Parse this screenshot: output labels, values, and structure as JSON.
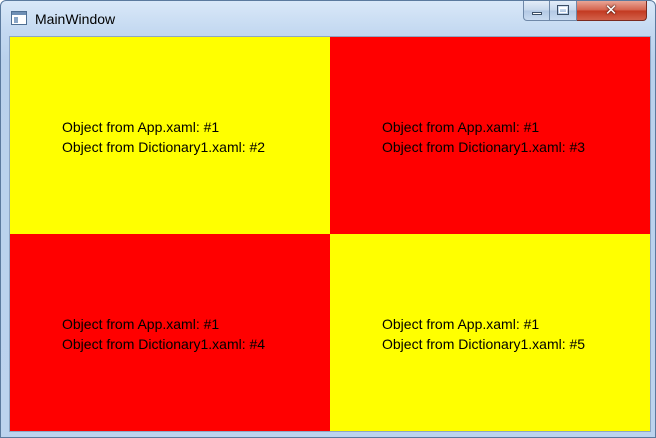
{
  "window": {
    "title": "MainWindow",
    "controls": {
      "minimize_icon": "minimize-icon",
      "maximize_icon": "maximize-icon",
      "close_icon": "close-icon",
      "close_glyph": "✕"
    }
  },
  "colors": {
    "yellow": "#ffff00",
    "red": "#ff0000"
  },
  "grid": {
    "cells": [
      {
        "id": "top-left",
        "color": "yellow",
        "line1": "Object from App.xaml: #1",
        "line2": "Object from Dictionary1.xaml: #2"
      },
      {
        "id": "top-right",
        "color": "red",
        "line1": "Object from App.xaml: #1",
        "line2": "Object from Dictionary1.xaml: #3"
      },
      {
        "id": "bottom-left",
        "color": "red",
        "line1": "Object from App.xaml: #1",
        "line2": "Object from Dictionary1.xaml: #4"
      },
      {
        "id": "bottom-right",
        "color": "yellow",
        "line1": "Object from App.xaml: #1",
        "line2": "Object from Dictionary1.xaml: #5"
      }
    ]
  }
}
